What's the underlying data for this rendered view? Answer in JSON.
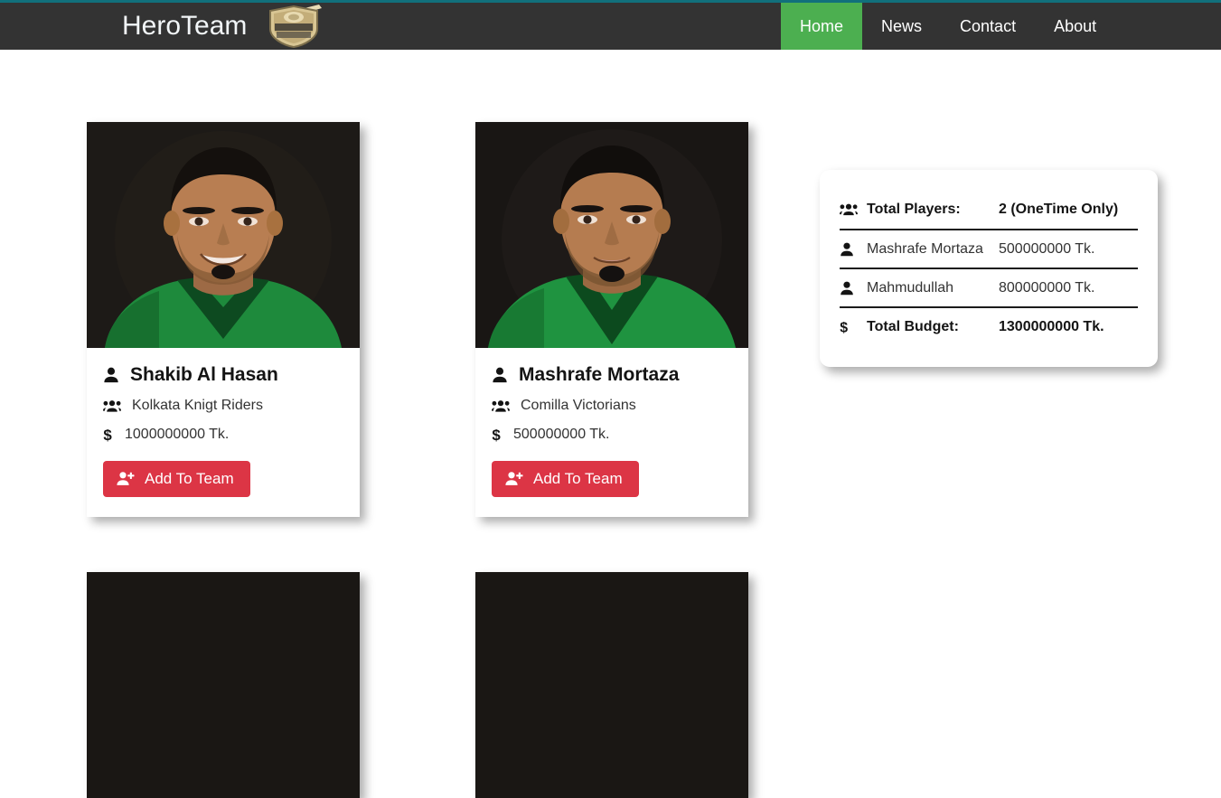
{
  "theme": {
    "accent_teal": "#11707c",
    "navbar_bg": "#333333",
    "active_nav_green": "#4caf50",
    "button_red": "#dc3545",
    "page_bg": "#ffffff",
    "text_dark": "#141414"
  },
  "header": {
    "brand_title": "HeroTeam",
    "brand_logo_icon": "challengers-shield-logo",
    "nav_items": [
      {
        "label": "Home",
        "active": true
      },
      {
        "label": "News",
        "active": false
      },
      {
        "label": "Contact",
        "active": false
      },
      {
        "label": "About",
        "active": false
      }
    ]
  },
  "players": [
    {
      "name": "Shakib Al Hasan",
      "team": "Kolkata Knigt Riders",
      "price": "1000000000 Tk.",
      "button_label": "Add To Team",
      "photo_alt": "player-portrait-green-jersey",
      "name_icon": "user-icon",
      "team_icon": "users-group-icon",
      "price_icon": "dollar-sign-icon",
      "button_icon": "user-plus-icon"
    },
    {
      "name": "Mashrafe Mortaza",
      "team": "Comilla Victorians",
      "price": "500000000 Tk.",
      "button_label": "Add To Team",
      "photo_alt": "player-portrait-green-jersey",
      "name_icon": "user-icon",
      "team_icon": "users-group-icon",
      "price_icon": "dollar-sign-icon",
      "button_icon": "user-plus-icon"
    }
  ],
  "summary": {
    "rows": [
      {
        "icon": "users-group-icon",
        "label": "Total Players:",
        "value": "2 (OneTime Only)",
        "bold": true
      },
      {
        "icon": "user-icon",
        "label": "Mashrafe Mortaza",
        "value": "500000000 Tk.",
        "bold": false
      },
      {
        "icon": "user-icon",
        "label": "Mahmudullah",
        "value": "800000000 Tk.",
        "bold": false
      },
      {
        "icon": "dollar-sign-icon",
        "label": "Total Budget:",
        "value": "1300000000 Tk.",
        "bold": true
      }
    ]
  }
}
